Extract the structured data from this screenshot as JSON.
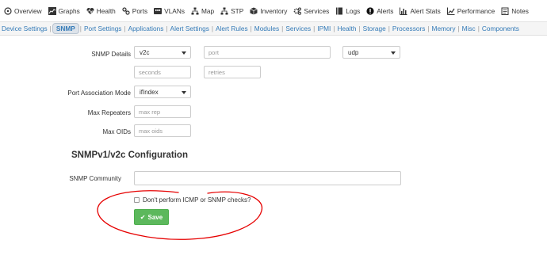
{
  "topnav": {
    "items": [
      {
        "label": "Overview",
        "icon": "overview-icon"
      },
      {
        "label": "Graphs",
        "icon": "graphs-icon"
      },
      {
        "label": "Health",
        "icon": "health-icon"
      },
      {
        "label": "Ports",
        "icon": "ports-icon"
      },
      {
        "label": "VLANs",
        "icon": "vlans-icon"
      },
      {
        "label": "Map",
        "icon": "map-icon"
      },
      {
        "label": "STP",
        "icon": "stp-icon"
      },
      {
        "label": "Inventory",
        "icon": "inventory-icon"
      },
      {
        "label": "Services",
        "icon": "services-icon"
      },
      {
        "label": "Logs",
        "icon": "logs-icon"
      },
      {
        "label": "Alerts",
        "icon": "alerts-icon"
      },
      {
        "label": "Alert Stats",
        "icon": "alert-stats-icon"
      },
      {
        "label": "Performance",
        "icon": "performance-icon"
      },
      {
        "label": "Notes",
        "icon": "notes-icon"
      }
    ]
  },
  "subnav": {
    "tabs": [
      {
        "label": "Device Settings",
        "active": false
      },
      {
        "label": "SNMP",
        "active": true
      },
      {
        "label": "Port Settings",
        "active": false
      },
      {
        "label": "Applications",
        "active": false
      },
      {
        "label": "Alert Settings",
        "active": false
      },
      {
        "label": "Alert Rules",
        "active": false
      },
      {
        "label": "Modules",
        "active": false
      },
      {
        "label": "Services",
        "active": false
      },
      {
        "label": "IPMI",
        "active": false
      },
      {
        "label": "Health",
        "active": false
      },
      {
        "label": "Storage",
        "active": false
      },
      {
        "label": "Processors",
        "active": false
      },
      {
        "label": "Memory",
        "active": false
      },
      {
        "label": "Misc",
        "active": false
      },
      {
        "label": "Components",
        "active": false
      }
    ]
  },
  "form": {
    "snmp_details_label": "SNMP Details",
    "version_value": "v2c",
    "port_placeholder": "port",
    "transport_value": "udp",
    "seconds_placeholder": "seconds",
    "retries_placeholder": "retries",
    "port_assoc_label": "Port Association Mode",
    "port_assoc_value": "ifIndex",
    "max_repeaters_label": "Max Repeaters",
    "max_repeaters_placeholder": "max rep",
    "max_oids_label": "Max OIDs",
    "max_oids_placeholder": "max oids",
    "section_title": "SNMPv1/v2c Configuration",
    "community_label": "SNMP Community",
    "community_value": "",
    "no_checks_label": "Don't perform ICMP or SNMP checks?",
    "save_label": "Save"
  },
  "colors": {
    "accent": "#337ab7",
    "save_green": "#5cb85c",
    "annotation_red": "#e60000"
  }
}
